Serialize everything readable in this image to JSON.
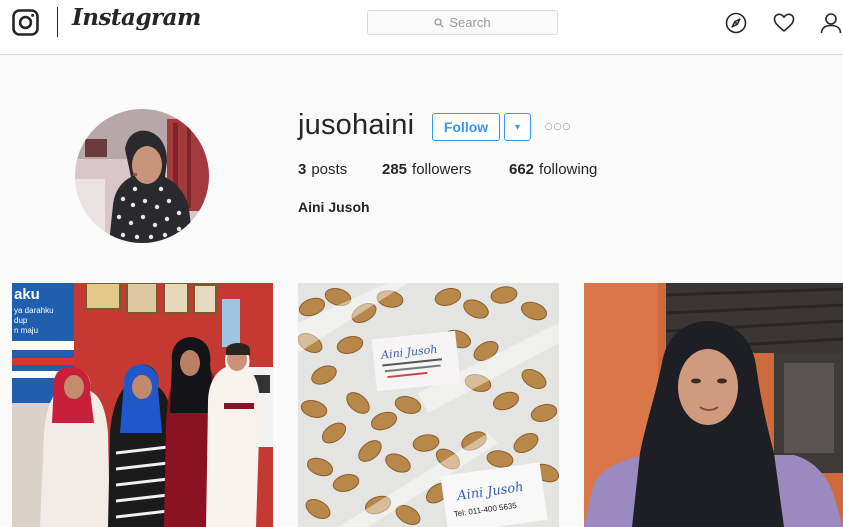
{
  "nav": {
    "logo_text": "Instagram",
    "search_placeholder": "Search",
    "icons": [
      "instagram-glyph-icon",
      "compass-icon",
      "heart-icon",
      "profile-icon",
      "search-icon"
    ]
  },
  "profile": {
    "username": "jusohaini",
    "follow_label": "Follow",
    "dropdown_label": "▾",
    "more_label": "○○○",
    "posts_count": "3",
    "posts_label": "posts",
    "followers_count": "285",
    "followers_label": "followers",
    "following_count": "662",
    "following_label": "following",
    "full_name": "Aini Jusoh"
  },
  "posts": [
    {
      "sign_lines": [
        "aku",
        "ya darahku",
        "dup",
        "n maju"
      ]
    },
    {
      "label_lines": [
        "Aini Jusoh",
        "Tel: 011-400 5635"
      ]
    },
    {}
  ],
  "colors": {
    "accent": "#3897f0",
    "text": "#262626",
    "border": "#dbdbdb",
    "background": "#fafafa"
  }
}
